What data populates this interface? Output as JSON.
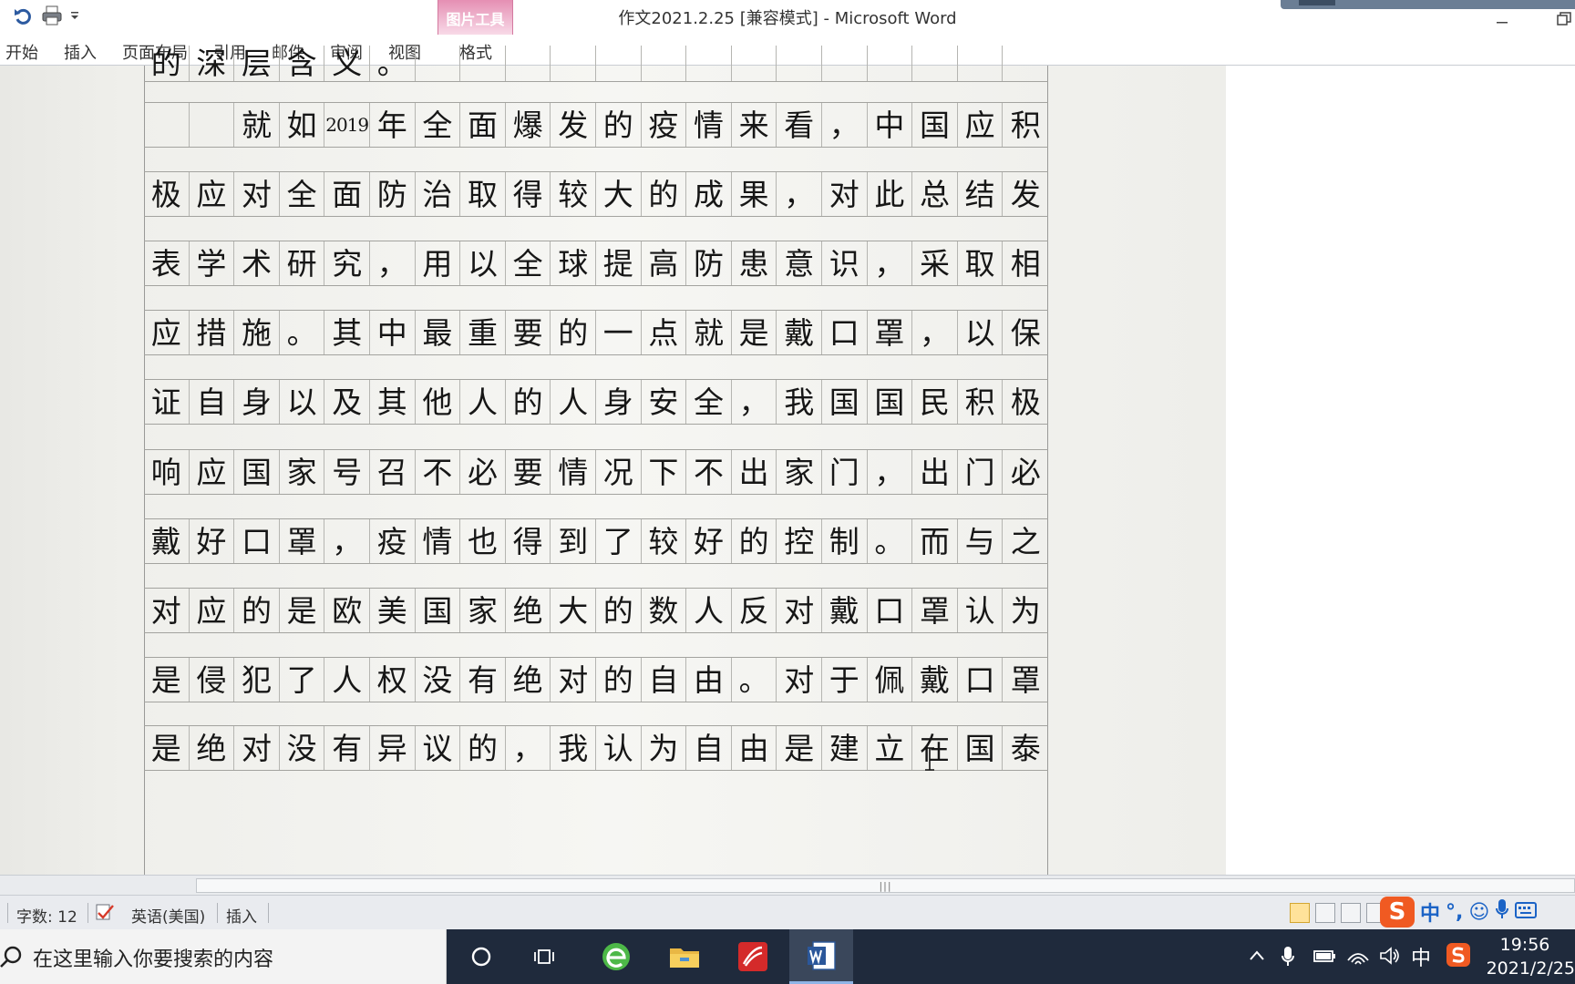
{
  "window": {
    "title": "作文2021.2.25 [兼容模式] - Microsoft Word",
    "context_tab_group": "图片工具"
  },
  "ribbon": {
    "tabs": [
      "开始",
      "插入",
      "页面布局",
      "引用",
      "邮件",
      "审阅",
      "视图",
      "格式"
    ]
  },
  "document": {
    "top_fragment": [
      "的",
      "深",
      "层",
      "含",
      "义",
      "。",
      "",
      "",
      "",
      "",
      "",
      "",
      "",
      "",
      "",
      "",
      "",
      "",
      "",
      ""
    ],
    "rows": [
      [
        "",
        "",
        "就",
        "如",
        "2019",
        "年",
        "全",
        "面",
        "爆",
        "发",
        "的",
        "疫",
        "情",
        "来",
        "看",
        "，",
        "中",
        "国",
        "应",
        "积"
      ],
      [
        "极",
        "应",
        "对",
        "全",
        "面",
        "防",
        "治",
        "取",
        "得",
        "较",
        "大",
        "的",
        "成",
        "果",
        "，",
        "对",
        "此",
        "总",
        "结",
        "发"
      ],
      [
        "表",
        "学",
        "术",
        "研",
        "究",
        "，",
        "用",
        "以",
        "全",
        "球",
        "提",
        "高",
        "防",
        "患",
        "意",
        "识",
        "，",
        "采",
        "取",
        "相"
      ],
      [
        "应",
        "措",
        "施",
        "。",
        "其",
        "中",
        "最",
        "重",
        "要",
        "的",
        "一",
        "点",
        "就",
        "是",
        "戴",
        "口",
        "罩",
        "，",
        "以",
        "保"
      ],
      [
        "证",
        "自",
        "身",
        "以",
        "及",
        "其",
        "他",
        "人",
        "的",
        "人",
        "身",
        "安",
        "全",
        "，",
        "我",
        "国",
        "国",
        "民",
        "积",
        "极"
      ],
      [
        "响",
        "应",
        "国",
        "家",
        "号",
        "召",
        "不",
        "必",
        "要",
        "情",
        "况",
        "下",
        "不",
        "出",
        "家",
        "门",
        "，",
        "出",
        "门",
        "必"
      ],
      [
        "戴",
        "好",
        "口",
        "罩",
        "，",
        "疫",
        "情",
        "也",
        "得",
        "到",
        "了",
        "较",
        "好",
        "的",
        "控",
        "制",
        "。",
        "而",
        "与",
        "之"
      ],
      [
        "对",
        "应",
        "的",
        "是",
        "欧",
        "美",
        "国",
        "家",
        "绝",
        "大",
        "的",
        "数",
        "人",
        "反",
        "对",
        "戴",
        "口",
        "罩",
        "认",
        "为"
      ],
      [
        "是",
        "侵",
        "犯",
        "了",
        "人",
        "权",
        "没",
        "有",
        "绝",
        "对",
        "的",
        "自",
        "由",
        "。",
        "对",
        "于",
        "佩",
        "戴",
        "口",
        "罩"
      ],
      [
        "是",
        "绝",
        "对",
        "没",
        "有",
        "异",
        "议",
        "的",
        "，",
        "我",
        "认",
        "为",
        "自",
        "由",
        "是",
        "建",
        "立",
        "在",
        "国",
        "泰"
      ]
    ]
  },
  "statusbar": {
    "word_count": "字数: 12",
    "language": "英语(美国)",
    "mode": "插入"
  },
  "ime": {
    "logo": "S",
    "items": [
      "中",
      "°,",
      "☺",
      "🎤",
      "⌨"
    ]
  },
  "taskbar": {
    "search_placeholder": "在这里输入你要搜索的内容",
    "tray_lang": "中",
    "time": "19:56",
    "date": "2021/2/25"
  }
}
